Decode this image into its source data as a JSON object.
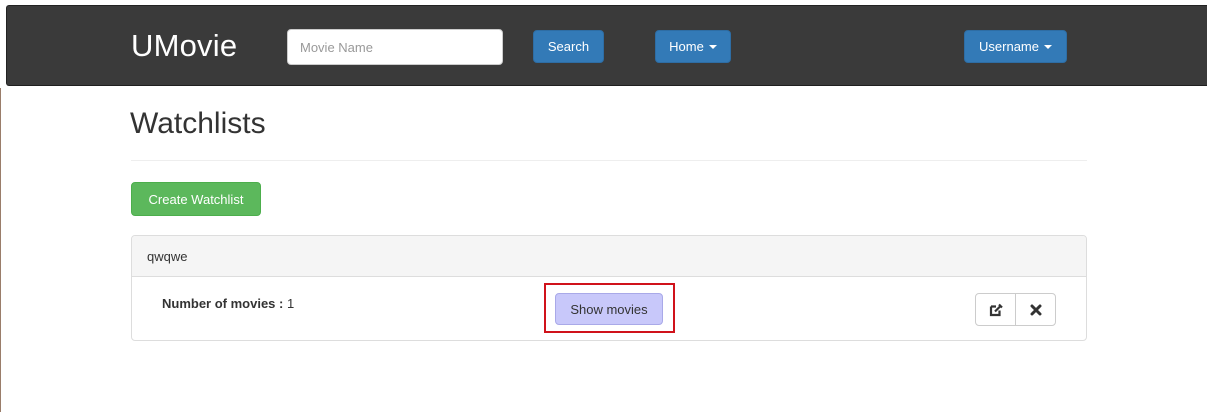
{
  "navbar": {
    "brand": "UMovie",
    "search_placeholder": "Movie Name",
    "search_label": "Search",
    "home_label": "Home",
    "user_label": "Username"
  },
  "page": {
    "title": "Watchlists",
    "create_label": "Create Watchlist"
  },
  "watchlists": [
    {
      "name": "qwqwe",
      "count_label": "Number of movies :",
      "count": "1",
      "show_label": "Show movies",
      "edit_icon": "edit-icon",
      "delete_icon": "close-icon"
    }
  ],
  "colors": {
    "navbar_bg": "#3a3a3a",
    "primary": "#337ab7",
    "success": "#5cb85c",
    "highlight_btn": "#c8c8fa",
    "highlight_border": "#d0121b"
  }
}
